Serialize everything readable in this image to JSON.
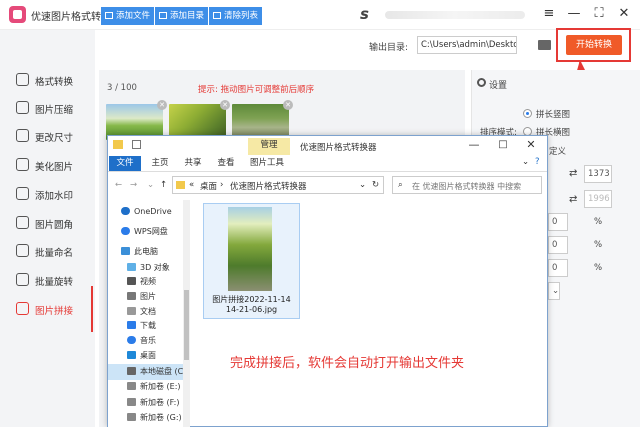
{
  "app": {
    "title": "优速图片格式转换器",
    "accent": "#e53935",
    "tb_s": "s"
  },
  "window_controls": [
    "≡",
    "—",
    "⛶",
    "✕"
  ],
  "sidebar": {
    "items": [
      {
        "label": "格式转换"
      },
      {
        "label": "图片压缩"
      },
      {
        "label": "更改尺寸"
      },
      {
        "label": "美化图片"
      },
      {
        "label": "添加水印"
      },
      {
        "label": "图片圆角"
      },
      {
        "label": "批量命名"
      },
      {
        "label": "批量旋转"
      },
      {
        "label": "图片拼接",
        "active": true
      }
    ]
  },
  "toolbar": {
    "add_file": "添加文件",
    "add_dir": "添加目录",
    "clear_list": "清除列表",
    "output_label": "输出目录:",
    "output_path": "C:\\Users\\admin\\Deskto",
    "start_button": "开始转换"
  },
  "work": {
    "count": "3 / 100",
    "hint": "提示: 拖动图片可调整前后顺序"
  },
  "settings": {
    "title": "设置",
    "mode_label": "排序模式:",
    "opt_long_vertical": "拼长竖图",
    "opt_long_horizontal": "拼长横图",
    "custom_fragment": "定义",
    "width_val": "1373",
    "height_val": "1996",
    "pct1": "0",
    "pct2": "0",
    "pct3": "0",
    "pct_sign": "%"
  },
  "explorer": {
    "manage_tab": "管理",
    "title": "优速图片格式转换器",
    "tabs": [
      "文件",
      "主页",
      "共享",
      "查看",
      "图片工具"
    ],
    "address": [
      "«",
      "桌面",
      "›",
      "优速图片格式转换器"
    ],
    "search_placeholder": "在 优速图片格式转换器 中搜索",
    "tree": [
      "OneDrive",
      "WPS网盘",
      "此电脑",
      "3D 对象",
      "视频",
      "图片",
      "文档",
      "下载",
      "音乐",
      "桌面",
      "本地磁盘 (C:",
      "新加卷 (E:)",
      "新加卷 (F:)",
      "新加卷 (G:)"
    ],
    "file_name": "图片拼接2022-11-14 14-21-06.jpg"
  },
  "caption": "完成拼接后，软件会自动打开输出文件夹"
}
